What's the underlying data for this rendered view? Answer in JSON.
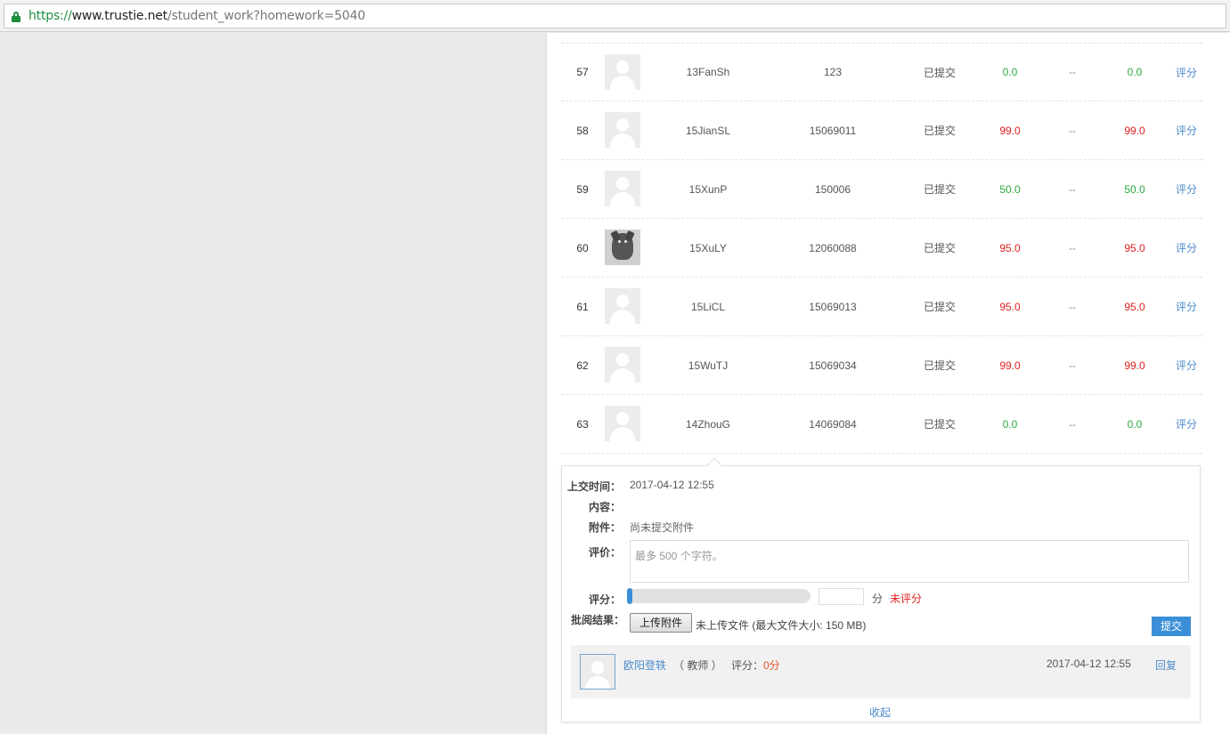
{
  "browser": {
    "url_scheme": "https://",
    "url_host": "www.trustie.net",
    "url_path": "/student_work?homework=5040"
  },
  "rows": [
    {
      "no": "57",
      "name": "13FanSh",
      "id": "123",
      "status": "已提交",
      "s1": "0.0",
      "s1_color": "green",
      "s2": "--",
      "s3": "0.0",
      "s3_color": "green",
      "op": "评分",
      "avatar": "default"
    },
    {
      "no": "58",
      "name": "15JianSL",
      "id": "15069011",
      "status": "已提交",
      "s1": "99.0",
      "s1_color": "red",
      "s2": "--",
      "s3": "99.0",
      "s3_color": "red",
      "op": "评分",
      "avatar": "default"
    },
    {
      "no": "59",
      "name": "15XunP",
      "id": "150006",
      "status": "已提交",
      "s1": "50.0",
      "s1_color": "green",
      "s2": "--",
      "s3": "50.0",
      "s3_color": "green",
      "op": "评分",
      "avatar": "default"
    },
    {
      "no": "60",
      "name": "15XuLY",
      "id": "12060088",
      "status": "已提交",
      "s1": "95.0",
      "s1_color": "red",
      "s2": "--",
      "s3": "95.0",
      "s3_color": "red",
      "op": "评分",
      "avatar": "dog"
    },
    {
      "no": "61",
      "name": "15LiCL",
      "id": "15069013",
      "status": "已提交",
      "s1": "95.0",
      "s1_color": "red",
      "s2": "--",
      "s3": "95.0",
      "s3_color": "red",
      "op": "评分",
      "avatar": "default"
    },
    {
      "no": "62",
      "name": "15WuTJ",
      "id": "15069034",
      "status": "已提交",
      "s1": "99.0",
      "s1_color": "red",
      "s2": "--",
      "s3": "99.0",
      "s3_color": "red",
      "op": "评分",
      "avatar": "default"
    },
    {
      "no": "63",
      "name": "14ZhouG",
      "id": "14069084",
      "status": "已提交",
      "s1": "0.0",
      "s1_color": "green",
      "s2": "--",
      "s3": "0.0",
      "s3_color": "green",
      "op": "评分",
      "avatar": "default"
    }
  ],
  "detail": {
    "submit_time_label": "上交时间：",
    "submit_time": "2017-04-12 12:55",
    "content_label": "内容：",
    "attachment_label": "附件：",
    "attachment_value": "尚未提交附件",
    "comment_label": "评价：",
    "comment_placeholder": "最多 500 个字符。",
    "score_label": "评分：",
    "score_fraction": 0,
    "score_unit": "分",
    "score_status": "未评分",
    "review_label": "批阅结果：",
    "upload_button": "上传附件",
    "no_file_text": "未上传文件 (最大文件大小: 150 MB)",
    "submit_button": "提交",
    "reply": {
      "teacher_name": "欧阳登轶",
      "role": "（ 教师 ）",
      "score_label": "评分：",
      "score_value": "0分",
      "time": "2017-04-12 12:55",
      "reply_link": "回复"
    },
    "collapse_link": "收起"
  },
  "colors": {
    "green": "#2aab3f",
    "red": "#e02020",
    "link": "#4b8bcb",
    "accent": "#3b8fd8"
  }
}
